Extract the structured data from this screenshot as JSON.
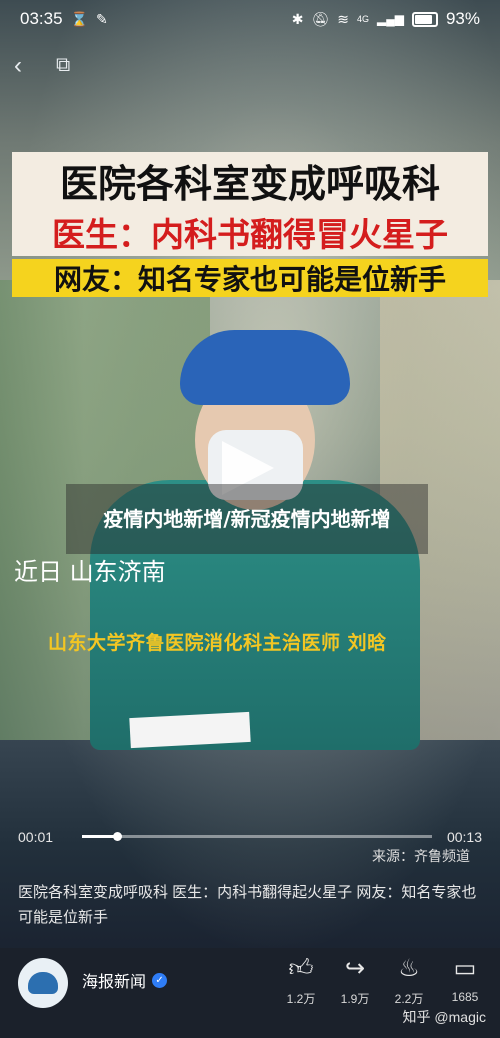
{
  "status": {
    "time": "03:35",
    "battery": "93%",
    "network": "4G"
  },
  "video": {
    "banner_line1": "医院各科室变成呼吸科",
    "banner_line2": "医生：内科书翻得冒火星子",
    "banner_line3": "网友：知名专家也可能是位新手",
    "headline": "疫情内地新增/新冠疫情内地新增",
    "caption_location": "近日 山东济南",
    "caption_doctor": "山东大学齐鲁医院消化科主治医师 刘晗",
    "current_time": "00:01",
    "duration": "00:13",
    "progress": 0.1,
    "source": "来源：齐鲁频道"
  },
  "description": "医院各科室变成呼吸科 医生：内科书翻得起火星子 网友：知名专家也可能是位新手",
  "author": {
    "name": "海报新闻",
    "verified": true
  },
  "actions": [
    {
      "name": "like",
      "icon": "thumbs-up-icon",
      "count": "1.2万"
    },
    {
      "name": "share",
      "icon": "share-icon",
      "count": "1.9万"
    },
    {
      "name": "favorite",
      "icon": "flame-icon",
      "count": "2.2万"
    },
    {
      "name": "comment",
      "icon": "comment-icon",
      "count": "1685"
    }
  ],
  "watermark": "知乎 @magic"
}
